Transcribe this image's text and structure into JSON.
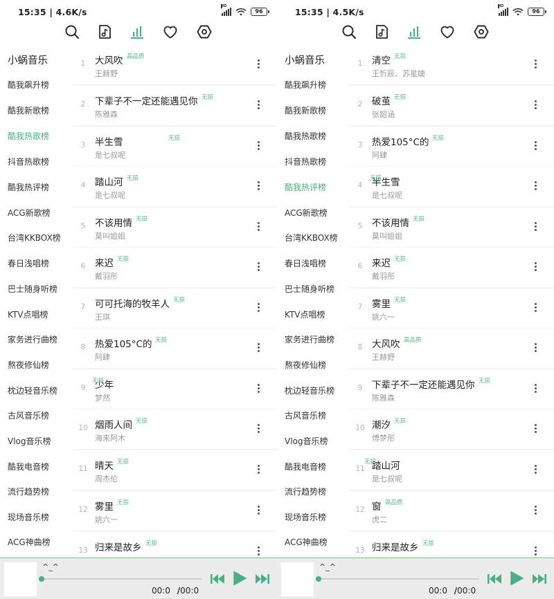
{
  "accent_color": "#4caf84",
  "screens": [
    {
      "status": {
        "time": "15:35 | 4.6K/s",
        "battery": "96",
        "network": "HD"
      },
      "nav": [
        {
          "icon": "search-icon",
          "active": false
        },
        {
          "icon": "music-note-icon",
          "active": false
        },
        {
          "icon": "chart-bars-icon",
          "active": true
        },
        {
          "icon": "heart-icon",
          "active": false
        },
        {
          "icon": "settings-hexagon-icon",
          "active": false
        }
      ],
      "brand": "小蜗音乐",
      "categories": [
        {
          "label": "酷我飙升榜",
          "active": false
        },
        {
          "label": "酷我新歌榜",
          "active": false
        },
        {
          "label": "酷我热歌榜",
          "active": true
        },
        {
          "label": "抖音热歌榜",
          "active": false
        },
        {
          "label": "酷我热评榜",
          "active": false
        },
        {
          "label": "ACG新歌榜",
          "active": false
        },
        {
          "label": "台湾KKBOX榜",
          "active": false
        },
        {
          "label": "春日浅唱榜",
          "active": false
        },
        {
          "label": "巴士随身听榜",
          "active": false
        },
        {
          "label": "KTV点唱榜",
          "active": false
        },
        {
          "label": "家务进行曲榜",
          "active": false
        },
        {
          "label": "熬夜修仙榜",
          "active": false
        },
        {
          "label": "枕边轻音乐榜",
          "active": false
        },
        {
          "label": "古风音乐榜",
          "active": false
        },
        {
          "label": "Vlog音乐榜",
          "active": false
        },
        {
          "label": "酷我电音榜",
          "active": false
        },
        {
          "label": "流行趋势榜",
          "active": false
        },
        {
          "label": "现场音乐榜",
          "active": false
        },
        {
          "label": "ACG神曲榜",
          "active": false
        }
      ],
      "songs": [
        {
          "rank": "1",
          "title": "大风吹",
          "artist": "王赫野",
          "badge": "高品质"
        },
        {
          "rank": "2",
          "title": "下辈子不一定还能遇见你",
          "artist": "陈雅森",
          "badge": "无损"
        },
        {
          "rank": "3",
          "title": "半生雪",
          "artist": "是七叔呢",
          "badge": "无损"
        },
        {
          "rank": "4",
          "title": "踏山河",
          "artist": "是七叔呢",
          "badge": "无损"
        },
        {
          "rank": "5",
          "title": "不该用情",
          "artist": "莫叫姐姐",
          "badge": "无损"
        },
        {
          "rank": "6",
          "title": "来迟",
          "artist": "戴羽彤",
          "badge": "无损"
        },
        {
          "rank": "7",
          "title": "可可托海的牧羊人",
          "artist": "王琪",
          "badge": "无损"
        },
        {
          "rank": "8",
          "title": "热爱105°C的",
          "artist": "阿肆",
          "badge": "无损"
        },
        {
          "rank": "9",
          "title": "少年",
          "artist": "梦然",
          "badge": "无损"
        },
        {
          "rank": "10",
          "title": "烟雨人间",
          "artist": "海来阿木",
          "badge": "无损"
        },
        {
          "rank": "11",
          "title": "晴天",
          "artist": "周杰伦",
          "badge": "无损"
        },
        {
          "rank": "12",
          "title": "雾里",
          "artist": "姚六一",
          "badge": "无损"
        },
        {
          "rank": "13",
          "title": "归来是故乡",
          "artist": "",
          "badge": "无损"
        }
      ],
      "player": {
        "title": "^_^",
        "current": "00:0",
        "separator": "/",
        "total": "00:0",
        "progress": 0
      }
    },
    {
      "status": {
        "time": "15:35 | 4.5K/s",
        "battery": "96",
        "network": "HD"
      },
      "nav": [
        {
          "icon": "search-icon",
          "active": false
        },
        {
          "icon": "music-note-icon",
          "active": false
        },
        {
          "icon": "chart-bars-icon",
          "active": true
        },
        {
          "icon": "heart-icon",
          "active": false
        },
        {
          "icon": "settings-hexagon-icon",
          "active": false
        }
      ],
      "brand": "小蜗音乐",
      "categories": [
        {
          "label": "酷我飙升榜",
          "active": false
        },
        {
          "label": "酷我新歌榜",
          "active": false
        },
        {
          "label": "酷我热歌榜",
          "active": false
        },
        {
          "label": "抖音热歌榜",
          "active": false
        },
        {
          "label": "酷我热评榜",
          "active": true
        },
        {
          "label": "ACG新歌榜",
          "active": false
        },
        {
          "label": "台湾KKBOX榜",
          "active": false
        },
        {
          "label": "春日浅唱榜",
          "active": false
        },
        {
          "label": "巴士随身听榜",
          "active": false
        },
        {
          "label": "KTV点唱榜",
          "active": false
        },
        {
          "label": "家务进行曲榜",
          "active": false
        },
        {
          "label": "熬夜修仙榜",
          "active": false
        },
        {
          "label": "枕边轻音乐榜",
          "active": false
        },
        {
          "label": "古风音乐榜",
          "active": false
        },
        {
          "label": "Vlog音乐榜",
          "active": false
        },
        {
          "label": "酷我电音榜",
          "active": false
        },
        {
          "label": "流行趋势榜",
          "active": false
        },
        {
          "label": "现场音乐榜",
          "active": false
        },
        {
          "label": "ACG神曲榜",
          "active": false
        }
      ],
      "songs": [
        {
          "rank": "1",
          "title": "清空",
          "artist": "王忻辰、苏星婕",
          "badge": "无损"
        },
        {
          "rank": "2",
          "title": "破茧",
          "artist": "张韶涵",
          "badge": "无损"
        },
        {
          "rank": "3",
          "title": "热爱105°C的",
          "artist": "阿肆",
          "badge": "无损"
        },
        {
          "rank": "4",
          "title": "半生雪",
          "artist": "是七叔呢",
          "badge": "无损"
        },
        {
          "rank": "5",
          "title": "不该用情",
          "artist": "莫叫姐姐",
          "badge": "无损"
        },
        {
          "rank": "6",
          "title": "来迟",
          "artist": "戴羽彤",
          "badge": "无损"
        },
        {
          "rank": "7",
          "title": "雾里",
          "artist": "姚六一",
          "badge": "无损"
        },
        {
          "rank": "8",
          "title": "大风吹",
          "artist": "王赫野",
          "badge": "高品质"
        },
        {
          "rank": "9",
          "title": "下辈子不一定还能遇见你",
          "artist": "陈雅森",
          "badge": "无损"
        },
        {
          "rank": "10",
          "title": "潮汐",
          "artist": "傅梦彤",
          "badge": "无损"
        },
        {
          "rank": "11",
          "title": "踏山河",
          "artist": "是七叔呢",
          "badge": "无损"
        },
        {
          "rank": "12",
          "title": "窗",
          "artist": "虎二",
          "badge": "高品质"
        },
        {
          "rank": "13",
          "title": "归来是故乡",
          "artist": "",
          "badge": "无损"
        }
      ],
      "player": {
        "title": "^_^",
        "current": "00:0",
        "separator": "/",
        "total": "00:0",
        "progress": 0
      }
    }
  ]
}
